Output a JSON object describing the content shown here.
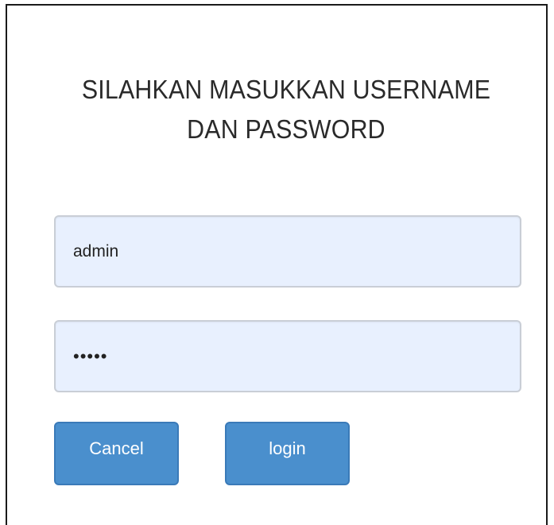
{
  "login_form": {
    "heading_line1": "SILAHKAN MASUKKAN USERNAME",
    "heading_line2": "DAN PASSWORD",
    "username_value": "admin",
    "password_value": "•••••",
    "cancel_label": "Cancel",
    "login_label": "login"
  },
  "colors": {
    "field_background": "#e8f0fe",
    "button_background": "#4a8fcd",
    "heading_text": "#2a2a2a"
  }
}
